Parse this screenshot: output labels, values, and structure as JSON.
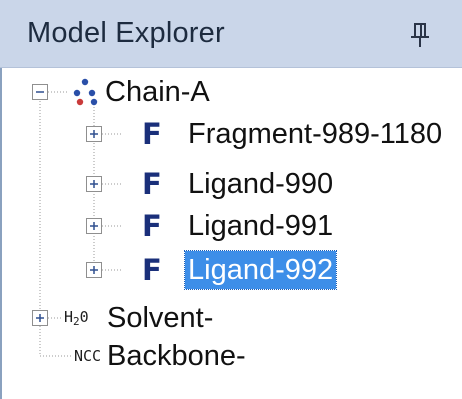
{
  "panel": {
    "title": "Model Explorer",
    "pin_icon": "pin-icon"
  },
  "tree": {
    "root": {
      "label": "Chain-A",
      "expanded": true,
      "icon": "molecule-icon",
      "children": [
        {
          "label": "Fragment-989-1180",
          "icon_text": "F",
          "expanded": false,
          "selected": false
        },
        {
          "label": "Ligand-990",
          "icon_text": "F",
          "expanded": false,
          "selected": false
        },
        {
          "label": "Ligand-991",
          "icon_text": "F",
          "expanded": false,
          "selected": false
        },
        {
          "label": "Ligand-992",
          "icon_text": "F",
          "expanded": false,
          "selected": true
        }
      ]
    },
    "solvent": {
      "label": "Solvent-",
      "icon_main": "H",
      "icon_sub": "2",
      "icon_tail": "0",
      "expanded": false
    },
    "backbone": {
      "label": "Backbone-",
      "icon_text": "NCC"
    }
  },
  "colors": {
    "title_bar": "#cad6e9",
    "selection": "#3d8ee8",
    "f_icon": "#1a2f7a",
    "molecule_icon": "#2a4fa8"
  }
}
